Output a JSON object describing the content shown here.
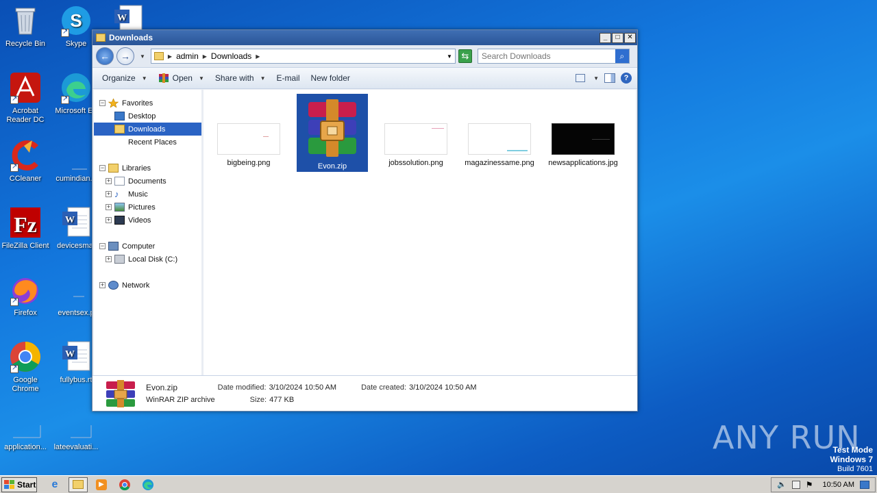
{
  "desktop": {
    "icons": [
      {
        "label": "Recycle Bin"
      },
      {
        "label": "Skype"
      },
      {
        "label": "Acrobat Reader DC"
      },
      {
        "label": "Microsoft Ed"
      },
      {
        "label": "CCleaner"
      },
      {
        "label": "cumindian.p"
      },
      {
        "label": "FileZilla Client"
      },
      {
        "label": "devicesmat"
      },
      {
        "label": "Firefox"
      },
      {
        "label": "eventsex.p"
      },
      {
        "label": "Google Chrome"
      },
      {
        "label": "fullybus.rt"
      },
      {
        "label": "application..."
      },
      {
        "label": "lateevaluati..."
      }
    ]
  },
  "window": {
    "title": "Downloads",
    "address": {
      "crumbs": [
        "admin",
        "Downloads"
      ]
    },
    "search": {
      "placeholder": "Search Downloads"
    },
    "toolbar": {
      "organize": "Organize",
      "open": "Open",
      "share_with": "Share with",
      "email": "E-mail",
      "new_folder": "New folder"
    },
    "nav": {
      "favorites": "Favorites",
      "desktop": "Desktop",
      "downloads": "Downloads",
      "recent_places": "Recent Places",
      "libraries": "Libraries",
      "documents": "Documents",
      "music": "Music",
      "pictures": "Pictures",
      "videos": "Videos",
      "computer": "Computer",
      "local_disk": "Local Disk (C:)",
      "network": "Network"
    },
    "files": [
      {
        "name": "bigbeing.png"
      },
      {
        "name": "Evon.zip"
      },
      {
        "name": "jobssolution.png"
      },
      {
        "name": "magazinessame.png"
      },
      {
        "name": "newsapplications.jpg"
      }
    ],
    "details": {
      "name": "Evon.zip",
      "type": "WinRAR ZIP archive",
      "date_modified_label": "Date modified:",
      "date_modified": "3/10/2024 10:50 AM",
      "date_created_label": "Date created:",
      "date_created": "3/10/2024 10:50 AM",
      "size_label": "Size:",
      "size": "477 KB"
    }
  },
  "taskbar": {
    "start": "Start",
    "clock": "10:50 AM"
  },
  "watermark": {
    "line1": "Test Mode",
    "line2": "Windows 7",
    "line3": "Build 7601",
    "brand": "ANY RUN"
  }
}
